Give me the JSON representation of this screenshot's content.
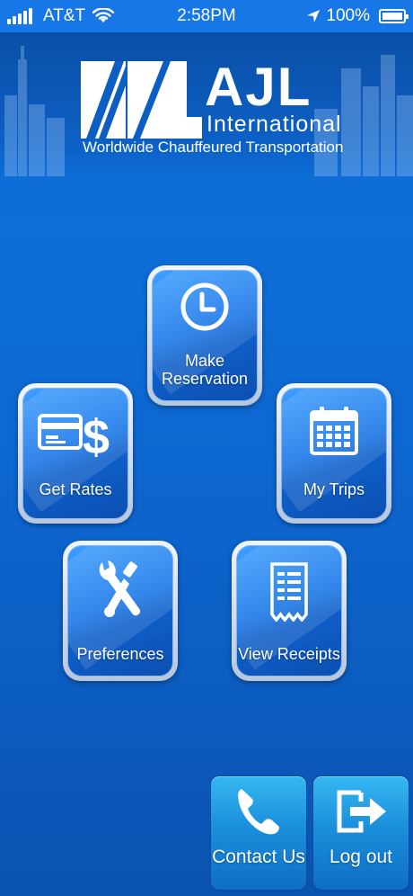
{
  "status_bar": {
    "carrier": "AT&T",
    "time": "2:58PM",
    "battery": "100%"
  },
  "logo": {
    "brand": "AJL",
    "subtitle": "International",
    "tagline": "Worldwide Chauffeured Transportation"
  },
  "menu": {
    "make_reservation": "Make\nReservation",
    "get_rates": "Get Rates",
    "my_trips": "My Trips",
    "preferences": "Preferences",
    "view_receipts": "View Receipts"
  },
  "bottom": {
    "contact_us": "Contact Us",
    "log_out": "Log out"
  },
  "colors": {
    "background": "#0c64cc",
    "tile_border": "#d6dfeb",
    "button_blue": "#1a8fdb"
  }
}
